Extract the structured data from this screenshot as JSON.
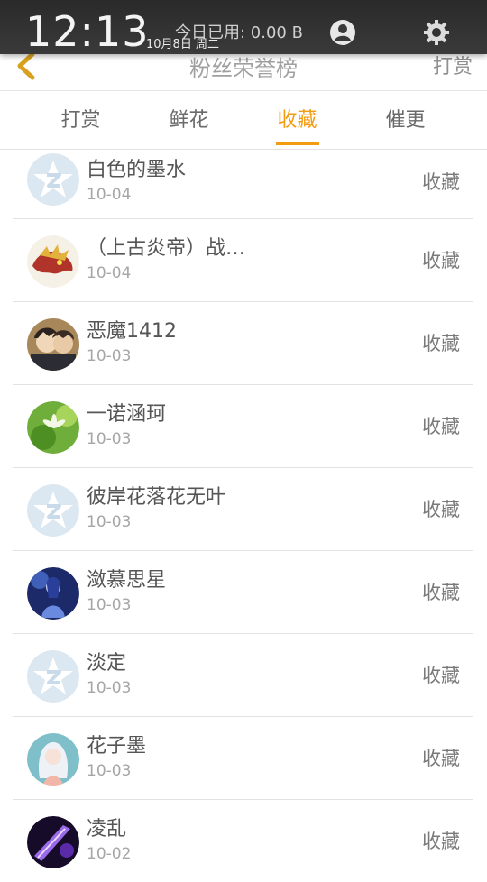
{
  "status": {
    "time": "12:13",
    "date": "10月8日 周二",
    "usage": "今日已用: 0.00 B"
  },
  "header": {
    "title": "粉丝荣誉榜",
    "right_label": "打赏"
  },
  "tabs": [
    {
      "label": "打赏",
      "active": false
    },
    {
      "label": "鲜花",
      "active": false
    },
    {
      "label": "收藏",
      "active": true
    },
    {
      "label": "催更",
      "active": false
    }
  ],
  "accent_color": "#f39c12",
  "rows": [
    {
      "name": "白色的墨水",
      "date": "10-04",
      "action": "收藏",
      "avatar": "default-avatar-icon"
    },
    {
      "name": "（上古炎帝）战…",
      "date": "10-04",
      "action": "收藏",
      "avatar": "dragon-avatar"
    },
    {
      "name": "恶魔1412",
      "date": "10-03",
      "action": "收藏",
      "avatar": "anime-boy-avatar"
    },
    {
      "name": "一诺涵珂",
      "date": "10-03",
      "action": "收藏",
      "avatar": "green-flower-avatar"
    },
    {
      "name": "彼岸花落花无叶",
      "date": "10-03",
      "action": "收藏",
      "avatar": "default-avatar-icon"
    },
    {
      "name": "潋慕思星",
      "date": "10-03",
      "action": "收藏",
      "avatar": "blue-figure-avatar"
    },
    {
      "name": "淡定",
      "date": "10-03",
      "action": "收藏",
      "avatar": "default-avatar-icon"
    },
    {
      "name": "花子墨",
      "date": "10-03",
      "action": "收藏",
      "avatar": "white-hair-girl-avatar"
    },
    {
      "name": "凌乱",
      "date": "10-02",
      "action": "收藏",
      "avatar": "purple-sword-avatar"
    }
  ]
}
